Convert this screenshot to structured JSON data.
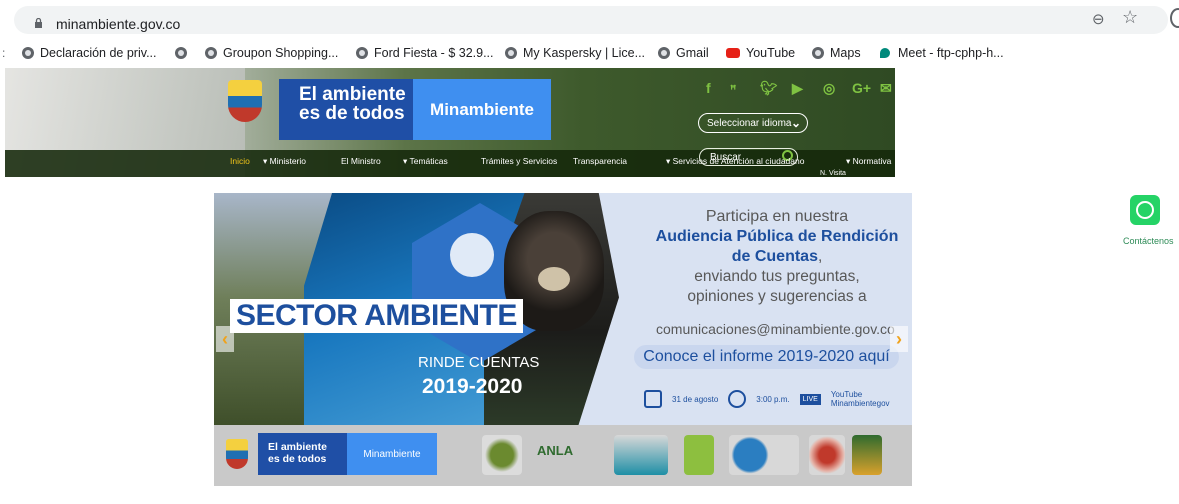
{
  "browser": {
    "url": "minambiente.gov.co",
    "bookmarks": [
      {
        "label": "Declaración de priv...",
        "icon": "globe-icon"
      },
      {
        "label": "",
        "icon": "globe-icon"
      },
      {
        "label": "Groupon Shopping...",
        "icon": "globe-icon"
      },
      {
        "label": "Ford Fiesta - $ 32.9...",
        "icon": "globe-icon"
      },
      {
        "label": "My Kaspersky | Lice...",
        "icon": "globe-icon"
      },
      {
        "label": "Gmail",
        "icon": "globe-icon"
      },
      {
        "label": "YouTube",
        "icon": "youtube-icon"
      },
      {
        "label": "Maps",
        "icon": "globe-icon"
      },
      {
        "label": "Meet - ftp-cphp-h...",
        "icon": "meet-icon"
      }
    ]
  },
  "site": {
    "logo_text_line1": "El ambiente",
    "logo_text_line2": "es de todos",
    "logo_brand": "Minambiente",
    "language_select": "Seleccionar idioma",
    "search_label": "Buscar",
    "nav": [
      "Inicio",
      "▾ Ministerio",
      "El Ministro",
      "▾ Temáticas",
      "Trámites y Servicios",
      "Transparencia",
      "▾ Servicios de Atención al ciudadano",
      "▾ Normativa"
    ],
    "nav_selected": "Inicio",
    "tiny_text": "N. Visita "
  },
  "banner": {
    "sector": "SECTOR AMBIENTE",
    "rinde": "RINDE CUENTAS",
    "year": "2019-2020",
    "promo_line1": "Participa en nuestra",
    "promo_line2": "Audiencia Pública de Rendición",
    "promo_line3": "de Cuentas",
    "promo_line3_suffix": ",",
    "promo_line4": "enviando tus preguntas,",
    "promo_line5": "opiniones y sugerencias a",
    "email": "comunicaciones@minambiente.gov.co",
    "informe": "Conoce el informe 2019-2020 aquí",
    "date": "31 de agosto",
    "time": "3:00 p.m.",
    "live": "LIVE",
    "channel_line1": "YouTube",
    "channel_line2": "Minambientegov",
    "strip_logo_line1": "El ambiente",
    "strip_logo_line2": "es de todos",
    "strip_brand": "Minambiente",
    "strip_logo_anla": "ANLA"
  },
  "whatsapp": {
    "label": "Contáctenos"
  },
  "colors": {
    "brand_blue": "#1f4fa6",
    "brand_light": "#3f8ff0",
    "nav_selected": "#f0c419",
    "whatsapp": "#25d366"
  }
}
